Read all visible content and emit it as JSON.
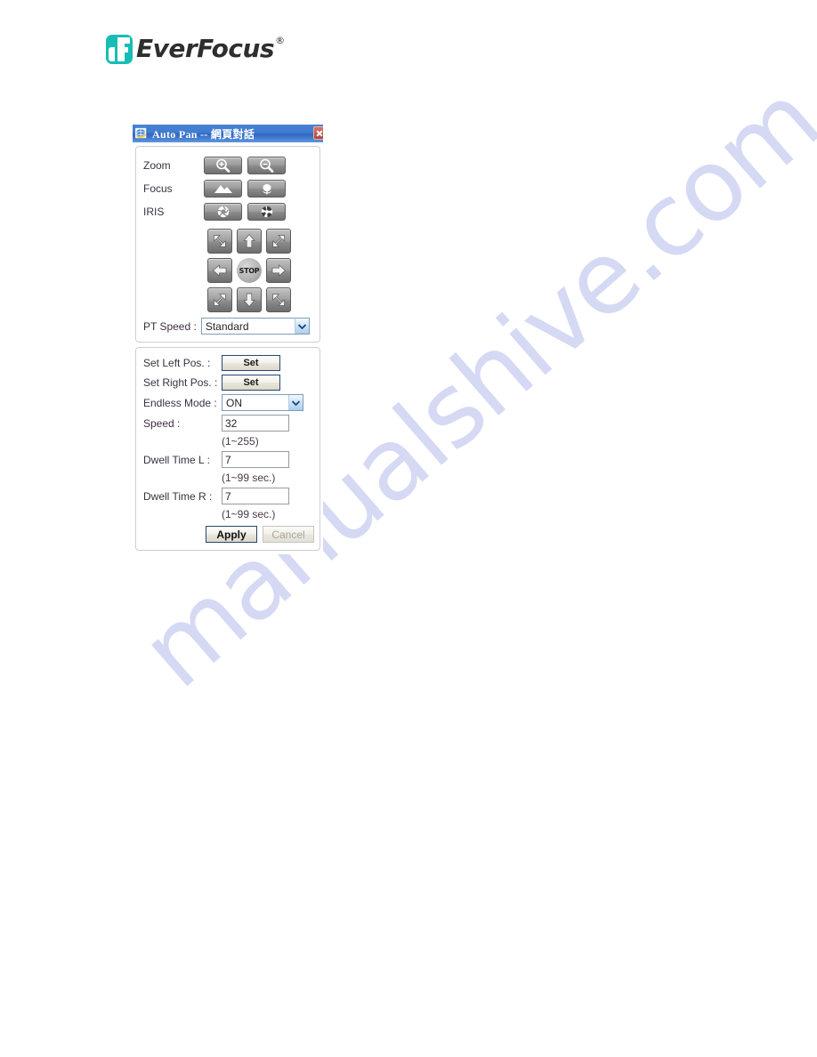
{
  "brand": {
    "name": "EverFocus",
    "registered_mark": "®",
    "logo_color": "#16bdb4",
    "wordmark_color": "#2e2e2e"
  },
  "watermark": {
    "text": "manualshive.com",
    "color": "#c9cdf0"
  },
  "dialog": {
    "title": "Auto Pan -- 網頁對話",
    "titlebar_color": "#3f7ad0",
    "close_label": "×",
    "lens": {
      "rows": [
        {
          "label": "Zoom",
          "buttons": [
            "zoom-in",
            "zoom-out"
          ]
        },
        {
          "label": "Focus",
          "buttons": [
            "focus-far",
            "focus-near"
          ]
        },
        {
          "label": "IRIS",
          "buttons": [
            "iris-open",
            "iris-close"
          ]
        }
      ]
    },
    "dpad": {
      "top": [
        "up-left",
        "up",
        "up-right"
      ],
      "middle": [
        "left",
        "stop",
        "right"
      ],
      "bottom": [
        "down-left",
        "down",
        "down-right"
      ],
      "stop_label": "STOP"
    },
    "pt_speed": {
      "label": "PT Speed :",
      "value": "Standard"
    },
    "settings": {
      "set_left_pos": {
        "label": "Set Left Pos. :",
        "button": "Set"
      },
      "set_right_pos": {
        "label": "Set Right Pos. :",
        "button": "Set"
      },
      "endless_mode": {
        "label": "Endless Mode :",
        "value": "ON"
      },
      "speed": {
        "label": "Speed :",
        "value": "32",
        "hint": "(1~255)"
      },
      "dwell_time_l": {
        "label": "Dwell Time L :",
        "value": "7",
        "hint": "(1~99 sec.)"
      },
      "dwell_time_r": {
        "label": "Dwell Time R :",
        "value": "7",
        "hint": "(1~99 sec.)"
      },
      "apply_label": "Apply",
      "cancel_label": "Cancel",
      "cancel_disabled": true
    }
  }
}
